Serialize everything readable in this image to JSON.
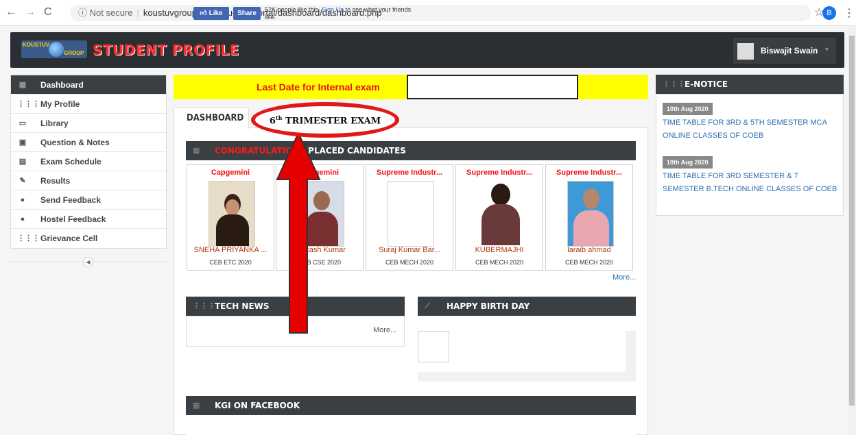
{
  "browser": {
    "security": "Not secure",
    "url": "koustuvgroup.ac.in/student-portal/dashboard/dashboard.php",
    "account_initial": "B"
  },
  "header": {
    "brand": "STUDENT PROFILE",
    "logo_text_top": "KOUSTUV",
    "logo_text_bottom": "GROUP",
    "user_name": "Biswajit Swain"
  },
  "sidebar": {
    "items": [
      {
        "label": "Dashboard",
        "icon": "dashboard-icon"
      },
      {
        "label": "My Profile",
        "icon": "grid-icon"
      },
      {
        "label": "Library",
        "icon": "laptop-icon"
      },
      {
        "label": "Question & Notes",
        "icon": "monitor-icon"
      },
      {
        "label": "Exam Schedule",
        "icon": "calendar-icon"
      },
      {
        "label": "Results",
        "icon": "pencil-icon"
      },
      {
        "label": "Send Feedback",
        "icon": "chat-icon"
      },
      {
        "label": "Hostel Feedback",
        "icon": "chat-icon"
      },
      {
        "label": "Grievance Cell",
        "icon": "grid-icon"
      }
    ]
  },
  "marquee": {
    "text": "Last Date for Internal exam"
  },
  "annotation": {
    "sup": "th",
    "pre": "6",
    "text": " TRIMESTER EXAM"
  },
  "tabs": {
    "dashboard": "DASHBOARD"
  },
  "placed": {
    "title_red": "CONGRATULATIONS",
    "title_white": "PLACED CANDIDATES",
    "more": "More...",
    "cards": [
      {
        "company": "Capgemini",
        "name": "SNEHA PRIYANKA ...",
        "branch": "CEB ETC 2020"
      },
      {
        "company": "Capgemini",
        "name": "Prakash Kumar",
        "branch": "CEB CSE 2020"
      },
      {
        "company": "Supreme Industr...",
        "name": "Suraj Kumar Bar...",
        "branch": "CEB MECH 2020"
      },
      {
        "company": "Supreme Industr...",
        "name": "KUBERMAJHI",
        "branch": "CEB MECH 2020"
      },
      {
        "company": "Supreme Industr...",
        "name": "laraib ahmad",
        "branch": "CEB MECH 2020"
      }
    ]
  },
  "technews": {
    "title": "TECH NEWS",
    "more": "More..."
  },
  "birthday": {
    "title": "HAPPY BIRTH DAY"
  },
  "facebook": {
    "title": "KGI ON FACEBOOK",
    "like": "Like",
    "share": "Share",
    "text": "52K people like this.",
    "signup": "Sign Up",
    "text2": "to see what your friends like."
  },
  "enotice": {
    "title": "E-NOTICE",
    "items": [
      {
        "date": "10th Aug 2020",
        "text": "TIME TABLE FOR 3RD & 5TH SEMESTER MCA ONLINE CLASSES OF COEB"
      },
      {
        "date": "10th Aug 2020",
        "text": "TIME TABLE FOR 3RD SEMESTER & 7 SEMESTER B.TECH ONLINE CLASSES OF COEB"
      }
    ]
  },
  "colors": {
    "accent_red": "#e11111",
    "panel_dark": "#3a3f44",
    "link_blue": "#2a6db0",
    "marquee_yellow": "#ffff00"
  }
}
